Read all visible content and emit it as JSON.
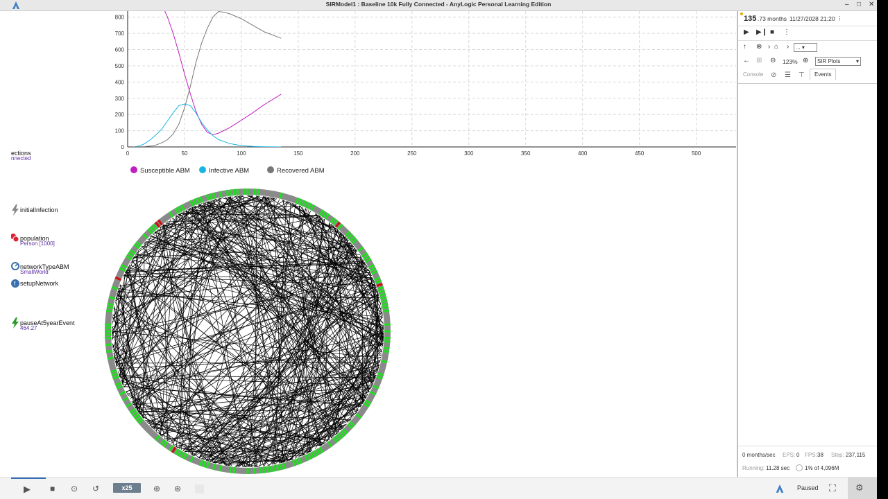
{
  "window": {
    "title": "SIRModel1 : Baseline 10k Fully Connected - AnyLogic Personal Learning Edition",
    "controls": [
      "–",
      "□",
      "✕"
    ]
  },
  "model_elements": {
    "cut_label": "ections",
    "cut_sub": "nnected",
    "items": [
      {
        "label": "initialInfection",
        "sub": "",
        "icon": "event-icon"
      },
      {
        "label": "population",
        "sub": "Person [1000]",
        "icon": "agent-population-icon"
      },
      {
        "label": "networkTypeABM",
        "sub": "SmallWorld",
        "icon": "parameter-icon"
      },
      {
        "label": "setupNetwork",
        "sub": "",
        "icon": "function-icon"
      },
      {
        "label": "pauseAt5yearEvent",
        "sub": "464.27",
        "icon": "event-icon"
      }
    ]
  },
  "chart_data": {
    "type": "line",
    "x_ticks": [
      0,
      50,
      100,
      150,
      200,
      250,
      300,
      350,
      400,
      450,
      500
    ],
    "y_ticks": [
      0,
      100,
      200,
      300,
      400,
      500,
      600,
      700,
      800
    ],
    "xlim": [
      0,
      535
    ],
    "ylim": [
      0,
      880
    ],
    "grid": true,
    "legend_position": "bottom-left",
    "series": [
      {
        "name": "Susceptible ABM",
        "color": "#c020c0",
        "x": [
          5,
          15,
          25,
          30,
          35,
          40,
          45,
          50,
          55,
          60,
          65,
          70,
          75,
          80,
          90,
          100,
          110,
          120,
          135
        ],
        "y": [
          995,
          985,
          935,
          880,
          800,
          700,
          580,
          450,
          330,
          220,
          140,
          90,
          75,
          85,
          120,
          165,
          210,
          260,
          325
        ]
      },
      {
        "name": "Infective ABM",
        "color": "#1ab4e0",
        "x": [
          5,
          10,
          15,
          20,
          25,
          30,
          35,
          40,
          45,
          50,
          55,
          60,
          65,
          70,
          75,
          80,
          90,
          100,
          110,
          120,
          135
        ],
        "y": [
          0,
          5,
          20,
          45,
          75,
          110,
          160,
          210,
          255,
          265,
          255,
          210,
          150,
          105,
          70,
          45,
          20,
          8,
          3,
          1,
          0
        ]
      },
      {
        "name": "Recovered ABM",
        "color": "#777777",
        "x": [
          5,
          15,
          20,
          25,
          30,
          35,
          40,
          45,
          50,
          55,
          60,
          65,
          70,
          75,
          80,
          85,
          90,
          100,
          110,
          120,
          135
        ],
        "y": [
          0,
          2,
          5,
          12,
          25,
          45,
          80,
          140,
          240,
          370,
          520,
          640,
          730,
          800,
          835,
          830,
          820,
          790,
          750,
          710,
          670
        ]
      }
    ]
  },
  "network": {
    "edges": 420,
    "ring_colors": {
      "susceptible": "#22dd22",
      "recovered": "#8a8a8a",
      "infective": "#cc1010"
    }
  },
  "side": {
    "time_value": "135",
    "time_unit": ".73 months",
    "date": "11/27/2028 21:20",
    "zoom": "123%",
    "breadcrumb_select": "...",
    "view_select": "SIR Plots",
    "tabs": [
      "Console",
      "Events"
    ],
    "status": {
      "speed": "0 months/sec",
      "eps_label": "EPS:",
      "eps": "0",
      "fps_label": "FPS:",
      "fps": "38",
      "step_label": "Step:",
      "step": "237,115",
      "running_label": "Running:",
      "running": "11.28 sec",
      "memory": "1% of 4,096M"
    }
  },
  "bottom": {
    "speed_label": "x25",
    "state": "Paused",
    "progress": 0.05
  }
}
